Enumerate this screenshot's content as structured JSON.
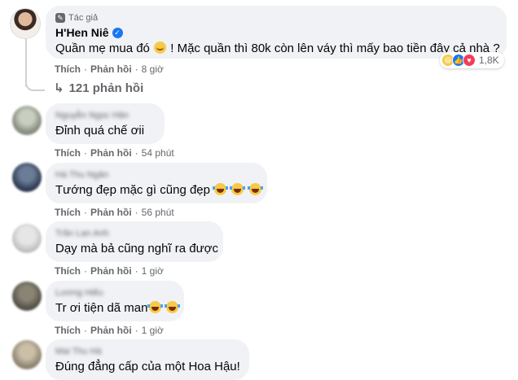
{
  "author_comment": {
    "badge": "Tác giả",
    "name": "H'Hen Niê",
    "text_part1": "Quần mẹ mua đó",
    "text_part2": "! Mặc quần thì 80k còn lên váy thì mấy bao tiền đây cả nhà ?",
    "emoji": "smiling-face-icon",
    "reaction_count": "1,8K",
    "actions": {
      "like": "Thích",
      "reply": "Phản hồi",
      "time": "8 giờ"
    },
    "replies_label": "121 phản hồi"
  },
  "comments": [
    {
      "name": "Nguyễn Ngọc Hân",
      "text": "Đỉnh quá chế ơii",
      "emojis": 0,
      "actions": {
        "like": "Thích",
        "reply": "Phản hồi",
        "time": "54 phút"
      },
      "avatar_color": "#9aa091"
    },
    {
      "name": "Hà Thu Ngân",
      "text": "Tướng đẹp mặc gì cũng đẹp",
      "emojis": 3,
      "actions": {
        "like": "Thích",
        "reply": "Phản hồi",
        "time": "56 phút"
      },
      "avatar_color": "#3b4b63"
    },
    {
      "name": "Trần Lan Anh",
      "text": "Dạy mà bả cũng nghĩ ra được",
      "emojis": 0,
      "actions": {
        "like": "Thích",
        "reply": "Phản hồi",
        "time": "1 giờ"
      },
      "avatar_color": "#c9c9c9"
    },
    {
      "name": "Lương Hiếu",
      "text": "Tr ơi tiện dã man",
      "emojis": 2,
      "actions": {
        "like": "Thích",
        "reply": "Phản hồi",
        "time": "1 giờ"
      },
      "avatar_color": "#6d6a60"
    },
    {
      "name": "Mai Thu Hà",
      "text": "Đúng đẳng cấp của một Hoa Hậu!",
      "emojis": 0,
      "avatar_color": "#a79b86"
    }
  ],
  "colors": {
    "bubble": "#f0f2f5",
    "meta": "#65676b",
    "verified": "#1877f2"
  }
}
